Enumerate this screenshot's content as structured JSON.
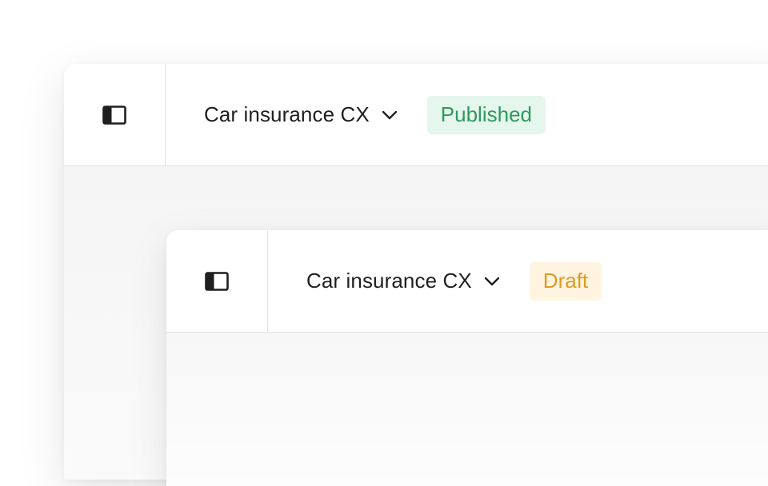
{
  "windows": [
    {
      "project_title": "Car insurance CX",
      "status": "Published",
      "status_color": "#2e9a5d",
      "status_bg": "#e5f6ec"
    },
    {
      "project_title": "Car insurance CX",
      "status": "Draft",
      "status_color": "#e09a21",
      "status_bg": "#fff4e0"
    }
  ],
  "icons": {
    "sidebar_toggle": "sidebar-toggle-icon",
    "dropdown": "chevron-down-icon"
  }
}
